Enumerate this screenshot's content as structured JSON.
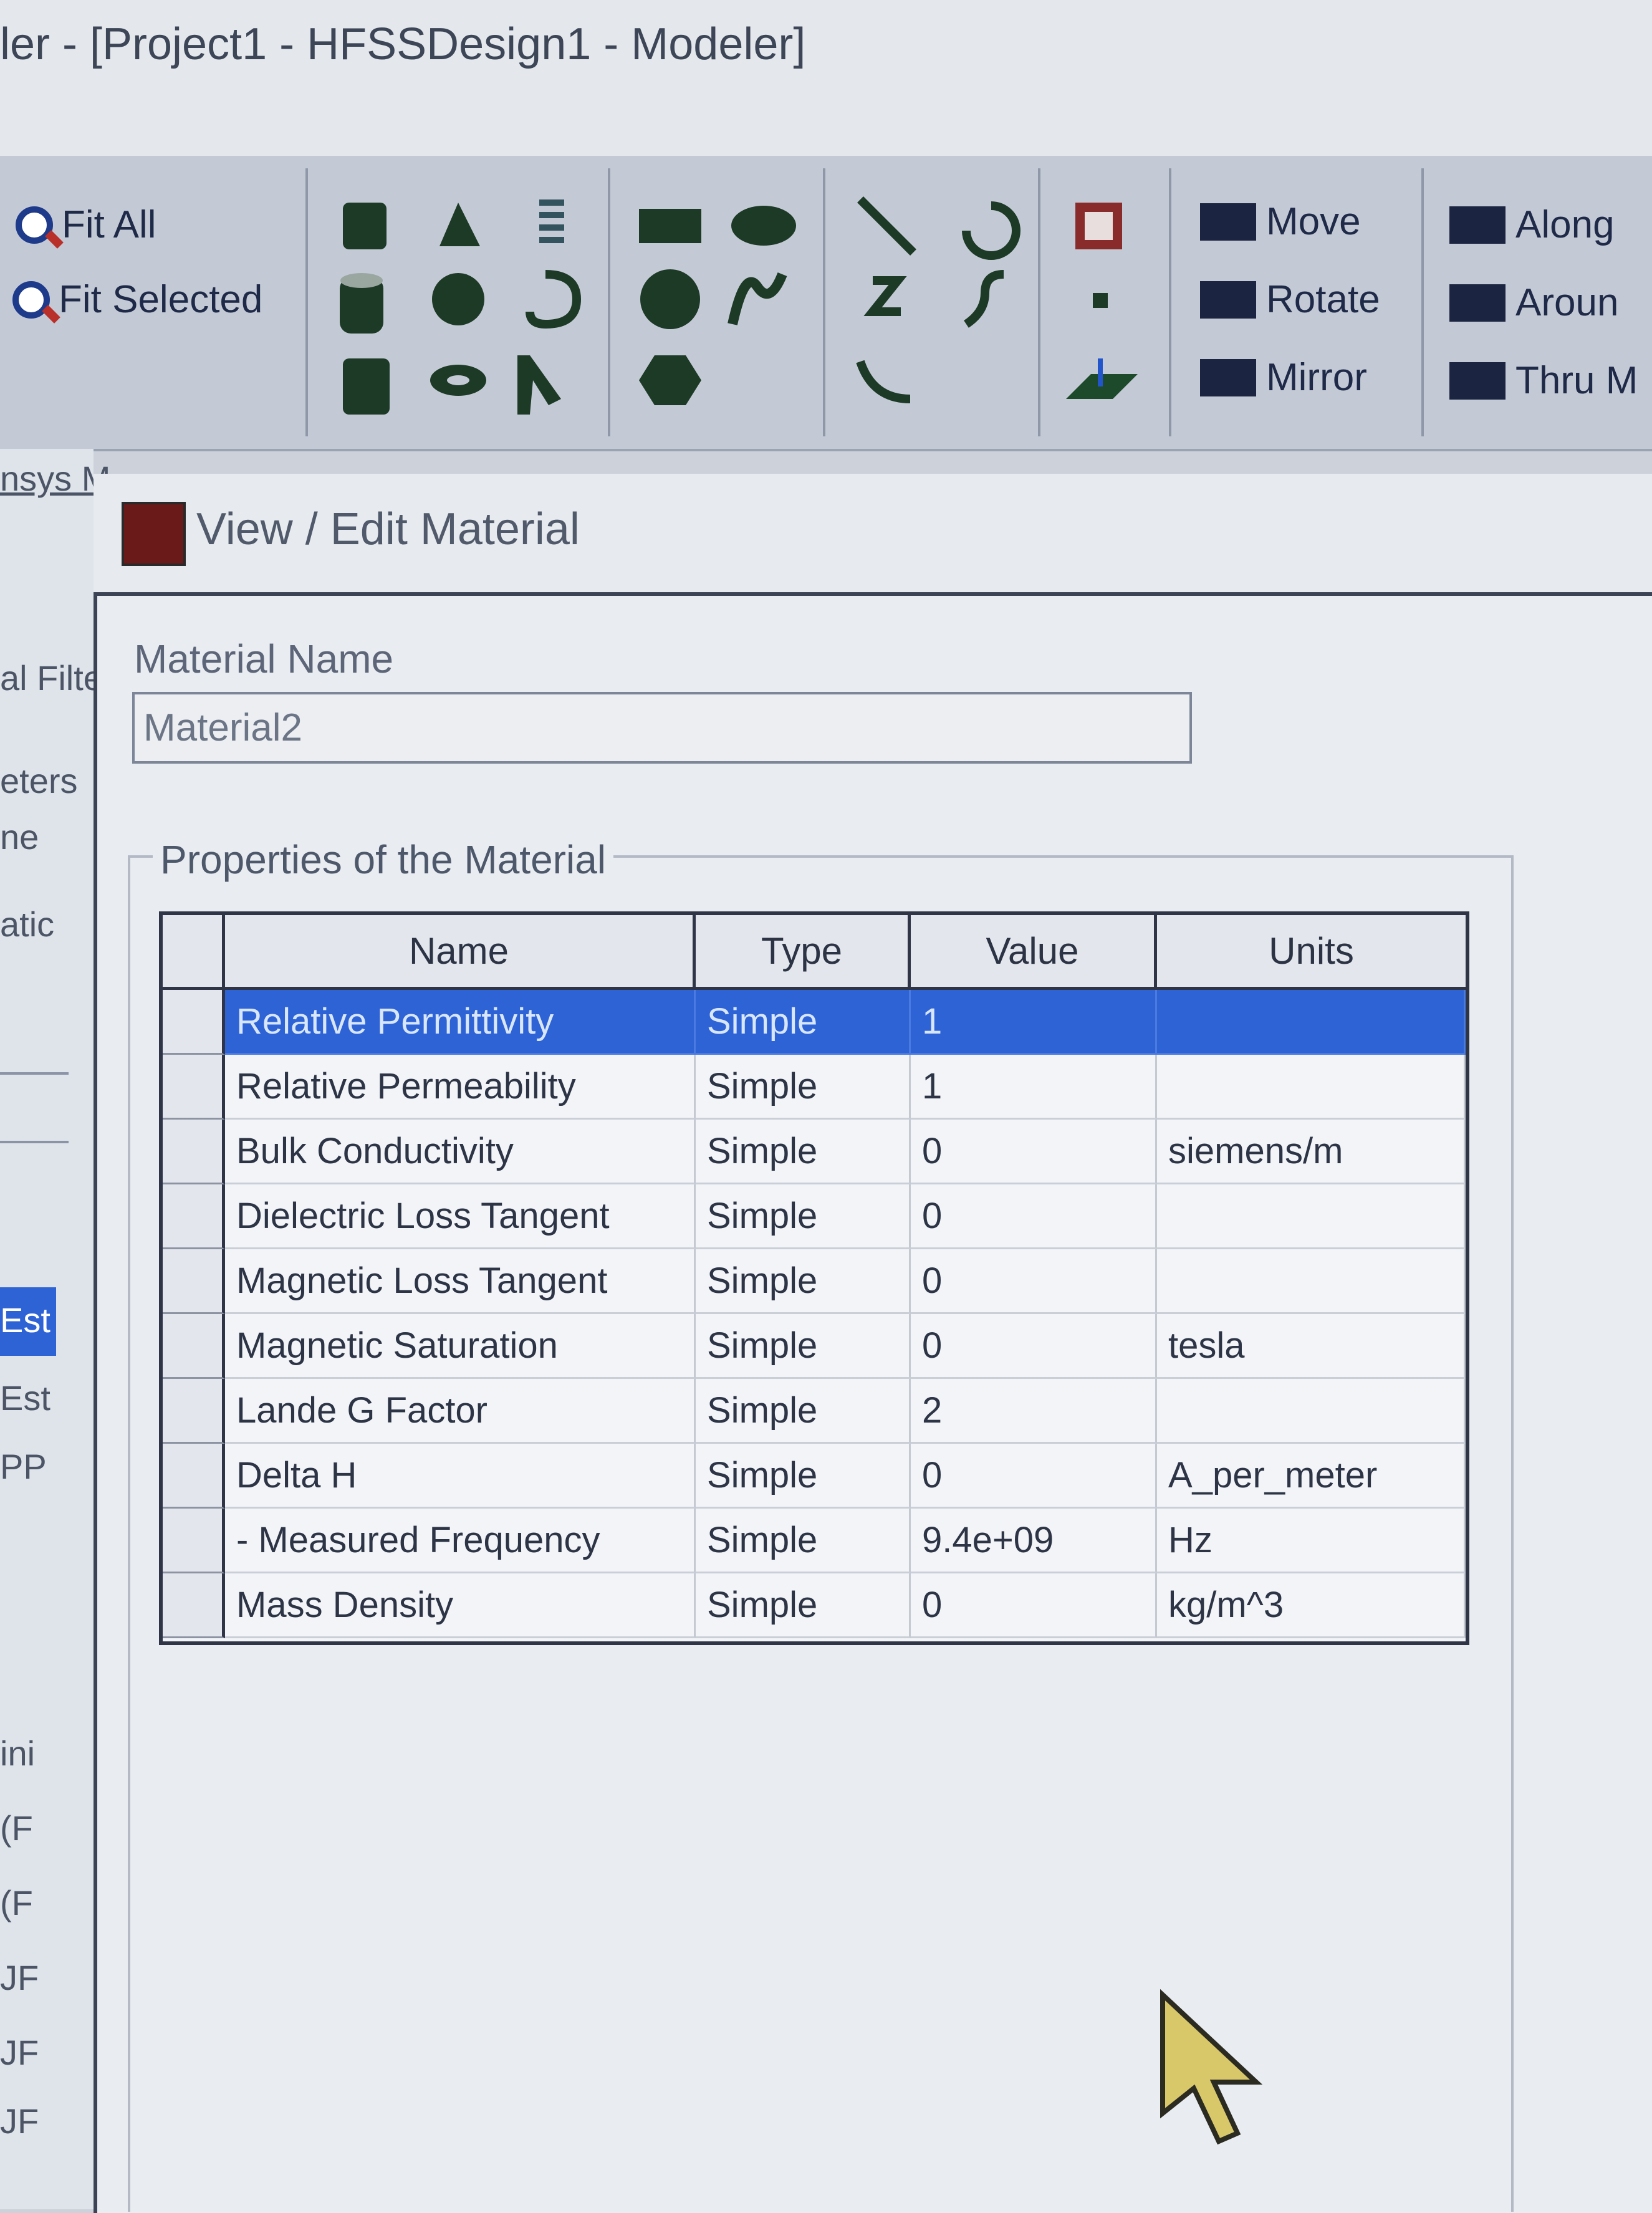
{
  "window": {
    "title": "ler - [Project1 - HFSSDesign1 - Modeler]"
  },
  "ribbon": {
    "fit_all": "Fit All",
    "fit_selected": "Fit Selected",
    "move": "Move",
    "rotate": "Rotate",
    "mirror": "Mirror",
    "along": "Along",
    "around": "Aroun",
    "thru": "Thru M"
  },
  "left_panel": {
    "items": [
      "nsys M",
      "al Filte",
      "eters",
      "ne",
      "atic",
      "Est",
      "Est",
      "PP",
      "ini",
      "(F",
      "(F",
      "JF",
      "JF",
      "JF"
    ]
  },
  "dialog": {
    "title": "View / Edit Material",
    "material_name_label": "Material Name",
    "material_name_value": "Material2",
    "properties_group_label": "Properties of the Material"
  },
  "table": {
    "headers": [
      "Name",
      "Type",
      "Value",
      "Units"
    ],
    "rows": [
      {
        "name": "Relative Permittivity",
        "type": "Simple",
        "value": "1",
        "units": ""
      },
      {
        "name": "Relative Permeability",
        "type": "Simple",
        "value": "1",
        "units": ""
      },
      {
        "name": "Bulk Conductivity",
        "type": "Simple",
        "value": "0",
        "units": "siemens/m"
      },
      {
        "name": "Dielectric Loss Tangent",
        "type": "Simple",
        "value": "0",
        "units": ""
      },
      {
        "name": "Magnetic Loss Tangent",
        "type": "Simple",
        "value": "0",
        "units": ""
      },
      {
        "name": "Magnetic Saturation",
        "type": "Simple",
        "value": "0",
        "units": "tesla"
      },
      {
        "name": "Lande G Factor",
        "type": "Simple",
        "value": "2",
        "units": ""
      },
      {
        "name": "Delta H",
        "type": "Simple",
        "value": "0",
        "units": "A_per_meter"
      },
      {
        "name": "- Measured Frequency",
        "type": "Simple",
        "value": "9.4e+09",
        "units": "Hz"
      },
      {
        "name": "Mass Density",
        "type": "Simple",
        "value": "0",
        "units": "kg/m^3"
      }
    ]
  },
  "colors": {
    "selection": "#2d63d4",
    "ribbon_bg": "#c4cad5",
    "dialog_bg": "#e9ecf0",
    "cursor": "#d9c86a"
  }
}
